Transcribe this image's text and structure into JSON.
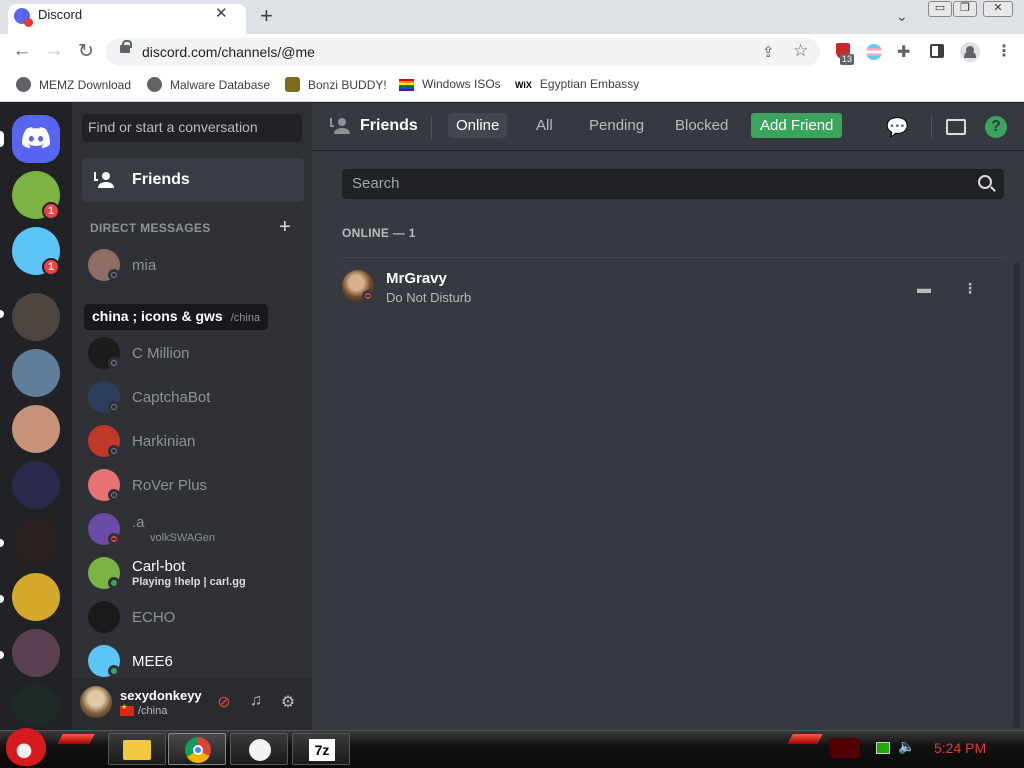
{
  "browser": {
    "tab_title": "Discord",
    "tab_close": "✕",
    "new_tab": "+",
    "tab_search": "⌄",
    "window_buttons": {
      "minimize": "▭",
      "maximize": "❐",
      "close": "✕"
    },
    "url": "discord.com/channels/@me",
    "extension_badge": "13",
    "bookmarks": [
      {
        "label": "MEMZ Download",
        "icon": "globe-icon",
        "color": "#5f6368"
      },
      {
        "label": "Malware Database",
        "icon": "globe-icon",
        "color": "#5f6368"
      },
      {
        "label": "Bonzi BUDDY!",
        "icon": "bonzi-icon",
        "color": "#7b6b1c"
      },
      {
        "label": "Windows ISOs",
        "icon": "rainbow-flag-icon",
        "color": "#e40303"
      },
      {
        "label": "Egyptian Embassy",
        "icon": "wix-icon",
        "color": "#000000"
      }
    ],
    "wix_glyph": "WiX"
  },
  "guilds": {
    "items": [
      {
        "name": "turtle-server",
        "badge": "1",
        "color": "#7cb342"
      },
      {
        "name": "mee6-server",
        "badge": "1",
        "color": "#5dc5f5"
      },
      {
        "name": "dark-server",
        "badge": "",
        "color": "#4e4540"
      },
      {
        "name": "megamind-server",
        "badge": "",
        "color": "#607d9b"
      },
      {
        "name": "face-server",
        "badge": "",
        "color": "#c8927a"
      },
      {
        "name": "monopoly-server",
        "badge": "",
        "color": "#2a2a4a"
      },
      {
        "name": "valorant-server",
        "badge": "",
        "color": "#2b2020"
      },
      {
        "name": "doge-server",
        "badge": "",
        "color": "#d4a82a"
      },
      {
        "name": "anime-server",
        "badge": "",
        "color": "#5a4050"
      },
      {
        "name": "c-server",
        "badge": "",
        "color": "#1e2a25"
      }
    ]
  },
  "dm": {
    "search_placeholder": "Find or start a conversation",
    "friends_label": "Friends",
    "header": "DIRECT MESSAGES",
    "add": "+",
    "tooltip": {
      "title": "china ; icons & gws",
      "sub": "/china"
    },
    "items": [
      {
        "name": "mia ",
        "sub": "",
        "status": "offline",
        "color": "#8d6e63"
      },
      {
        "name": "C Million",
        "sub": "",
        "status": "offline",
        "color": "#1c1c1c"
      },
      {
        "name": "CaptchaBot",
        "sub": "",
        "status": "offline",
        "color": "#2c3e5c"
      },
      {
        "name": "Harkinian",
        "sub": "",
        "status": "offline",
        "color": "#c0392b"
      },
      {
        "name": "RoVer Plus",
        "sub": "",
        "status": "offline",
        "color": "#e57373"
      },
      {
        "name": ".a",
        "sub": "volkSWAGen",
        "status": "dnd",
        "color": "#6a4ca8"
      },
      {
        "name": "Carl-bot",
        "sub": "Playing !help | carl.gg",
        "status": "online",
        "color": "#7cb342"
      },
      {
        "name": "ECHO",
        "sub": "",
        "status": "offline",
        "color": "#1a1a1a"
      },
      {
        "name": "MEE6",
        "sub": "",
        "status": "online",
        "color": "#5dc5f5"
      }
    ]
  },
  "user": {
    "name": "sexydonkeyy",
    "status": "/china"
  },
  "friends_page": {
    "title": "Friends",
    "tabs": [
      "Online",
      "All",
      "Pending",
      "Blocked"
    ],
    "active_tab": "Online",
    "add_friend": "Add Friend",
    "help": "?",
    "search_placeholder": "Search",
    "online_header": "ONLINE — 1",
    "friends": [
      {
        "name": "MrGravy",
        "status": "Do Not Disturb"
      }
    ]
  },
  "taskbar": {
    "clock": "5:24 PM",
    "apps": [
      "explorer",
      "chrome",
      "paint",
      "7zip"
    ],
    "seven_zip": "7z"
  },
  "colors": {
    "blurple": "#5865f2",
    "green": "#3ba55d",
    "red": "#ed4245"
  }
}
